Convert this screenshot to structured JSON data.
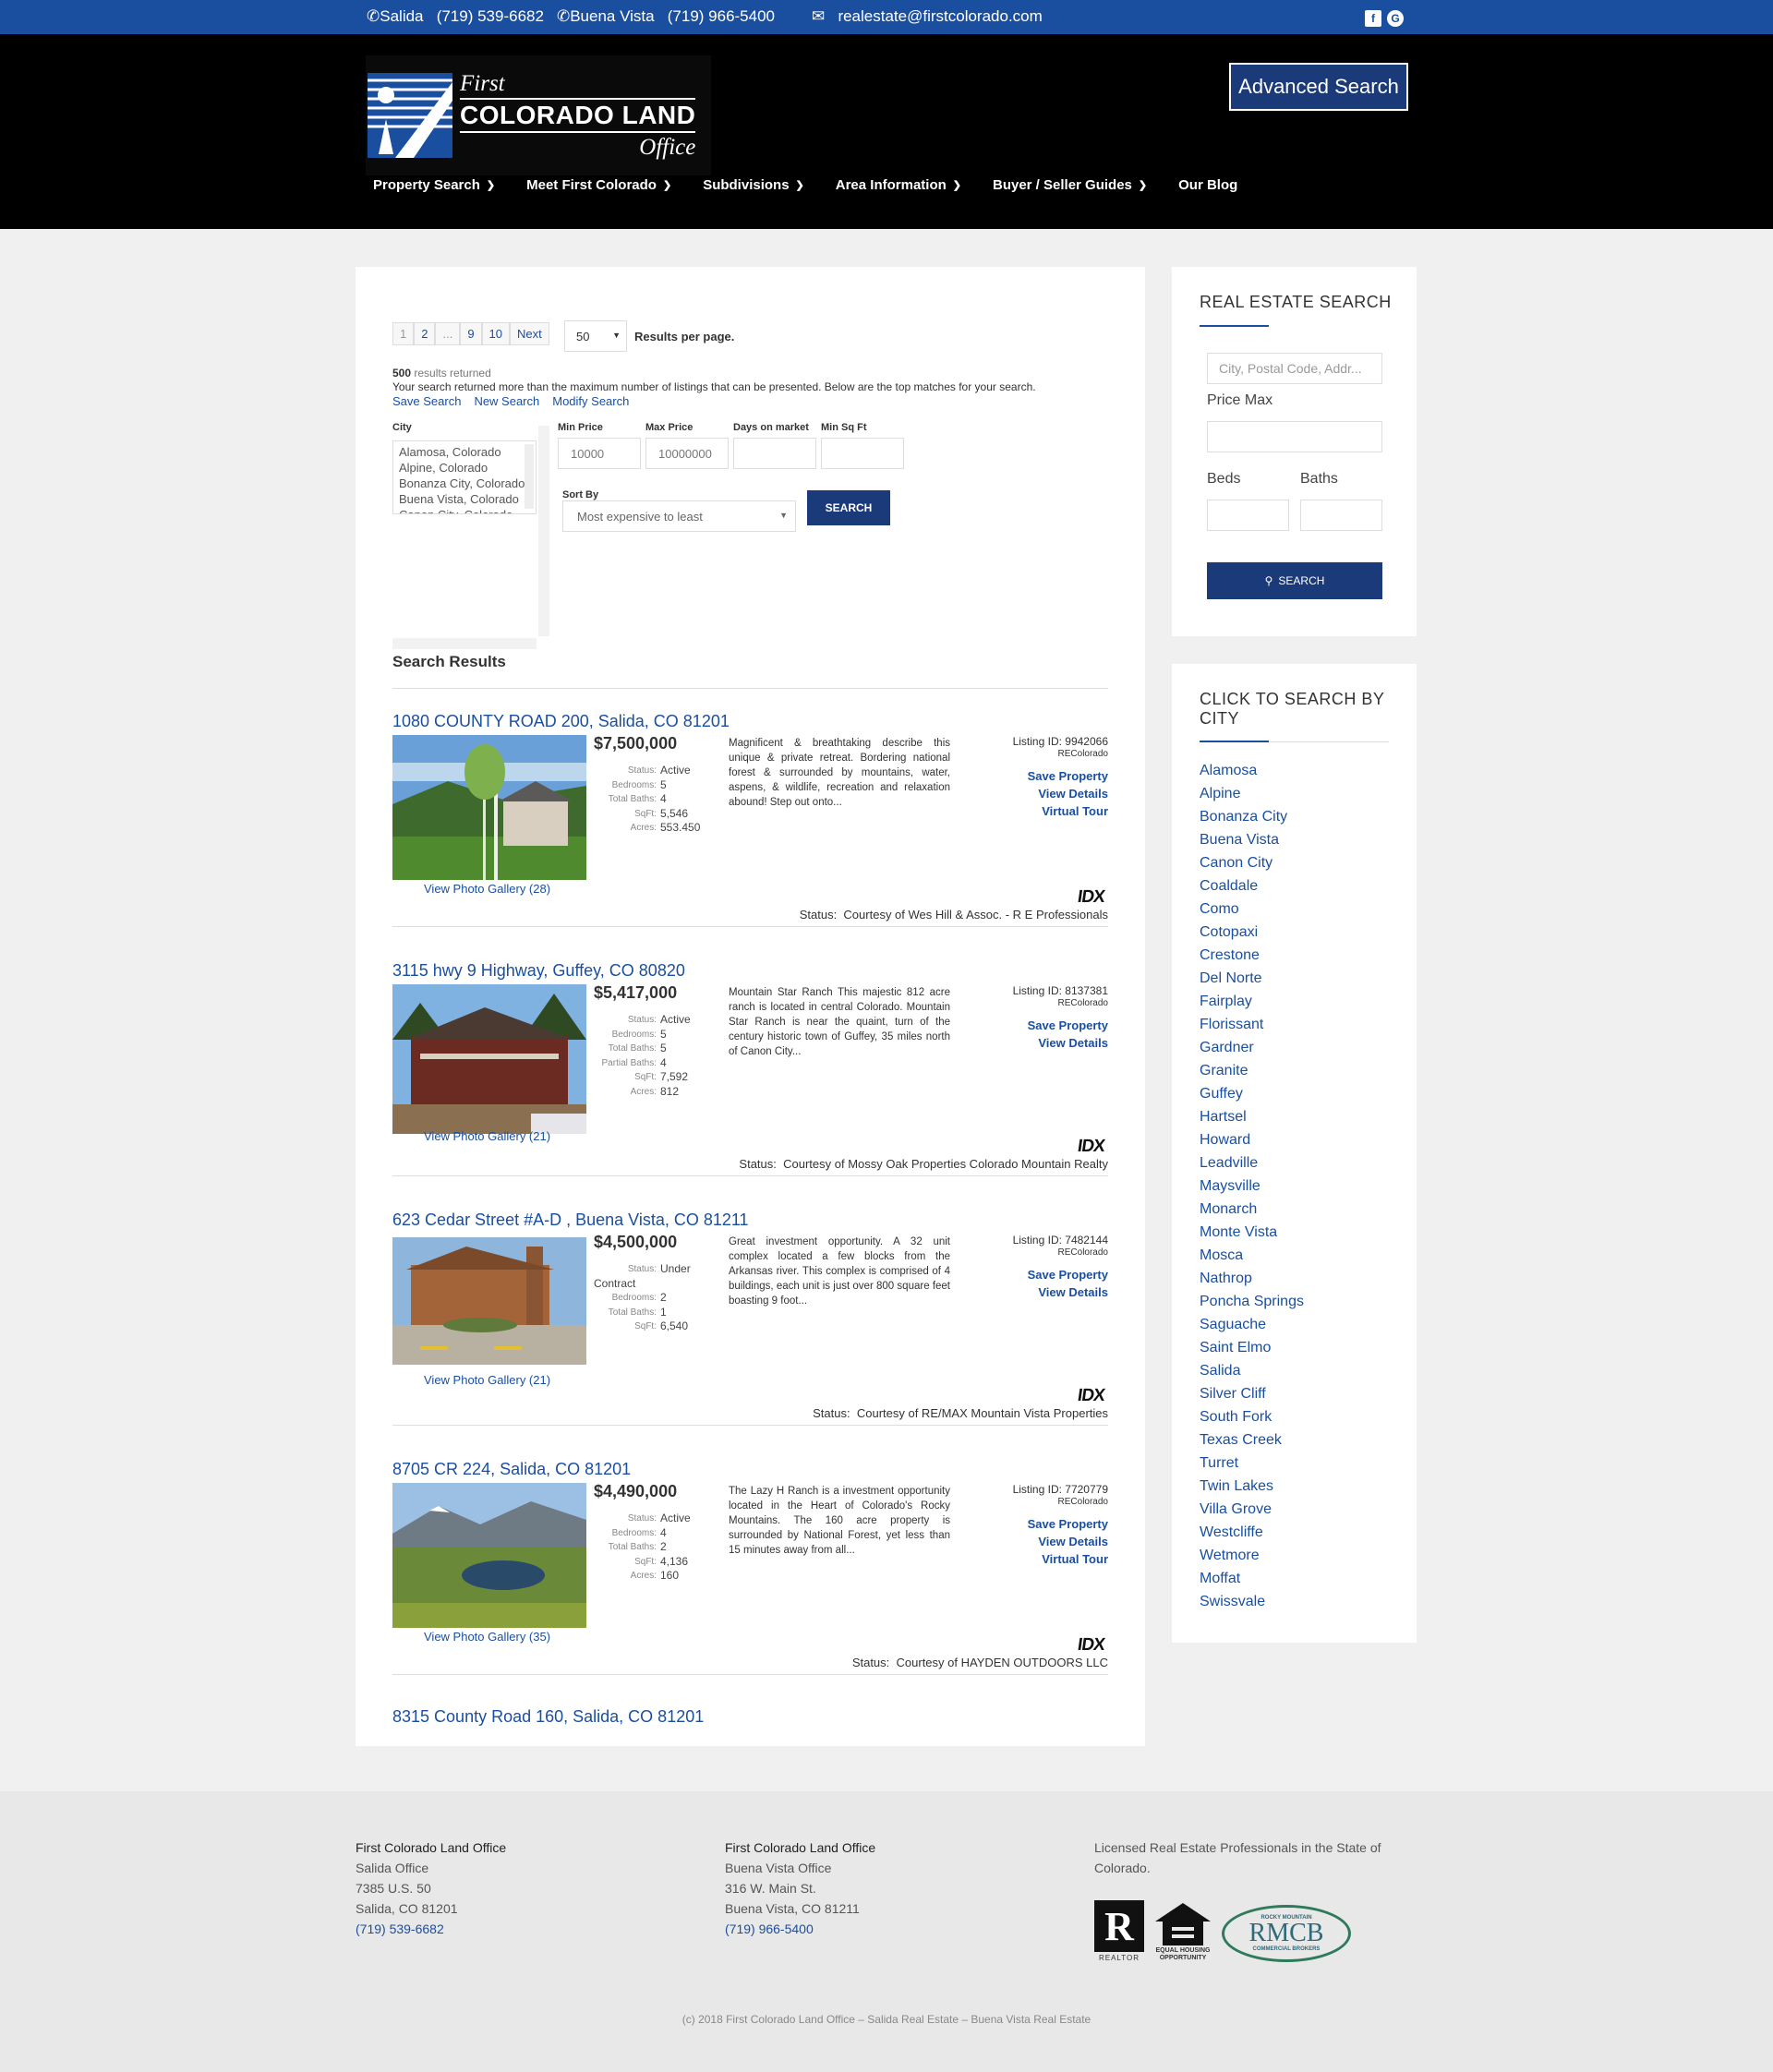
{
  "topbar": {
    "salida_label": "Salida",
    "salida_phone": "(719) 539-6682",
    "bv_label": "Buena Vista",
    "bv_phone": "(719) 966-5400",
    "email": "realestate@firstcolorado.com"
  },
  "logo": {
    "first": "First",
    "main": "COLORADO LAND",
    "office": "Office"
  },
  "header": {
    "advanced_search": "Advanced Search"
  },
  "nav": [
    {
      "label": "Property Search"
    },
    {
      "label": "Meet First Colorado"
    },
    {
      "label": "Subdivisions"
    },
    {
      "label": "Area Information"
    },
    {
      "label": "Buyer / Seller Guides"
    },
    {
      "label": "Our Blog"
    }
  ],
  "pager": {
    "pages": [
      "1",
      "2",
      "...",
      "9",
      "10",
      "Next"
    ],
    "per_page": "50",
    "per_page_label": "Results per page."
  },
  "results_info": {
    "count": "500",
    "count_suffix": "results returned",
    "message": "Your search returned more than the maximum number of listings that can be presented. Below are the top matches for your search.",
    "save_search": "Save Search",
    "new_search": "New Search",
    "modify_search": "Modify Search"
  },
  "filters": {
    "city_label": "City",
    "cities": [
      "Alamosa, Colorado",
      "Alpine, Colorado",
      "Bonanza City, Colorado",
      "Buena Vista, Colorado",
      "Canon City, Colorado"
    ],
    "min_price_label": "Min Price",
    "min_price": "10000",
    "max_price_label": "Max Price",
    "max_price": "10000000",
    "days_label": "Days on market",
    "sqft_label": "Min Sq Ft",
    "sort_label": "Sort By",
    "sort_value": "Most expensive to least",
    "search_button": "SEARCH"
  },
  "search_results_title": "Search Results",
  "listings": [
    {
      "title": "1080 COUNTY ROAD 200, Salida, CO 81201",
      "price": "$7,500,000",
      "status": "Active",
      "bedrooms": "5",
      "total_baths": "4",
      "sqft": "5,546",
      "acres": "553.450",
      "description": "Magnificent & breathtaking describe this unique & private retreat. Bordering national forest & surrounded by mountains, water, aspens, & wildlife, recreation and relaxation abound! Step out onto...",
      "listing_id": "Listing ID: 9942066",
      "source": "REColorado",
      "save": "Save Property",
      "details": "View Details",
      "tour": "Virtual Tour",
      "gallery": "View Photo Gallery (28)",
      "courtesy_label": "Status:",
      "courtesy": "Courtesy of Wes Hill & Assoc. - R E Professionals"
    },
    {
      "title": "3115 hwy 9 Highway, Guffey, CO 80820",
      "price": "$5,417,000",
      "status": "Active",
      "bedrooms": "5",
      "total_baths": "5",
      "partial_baths": "4",
      "sqft": "7,592",
      "acres": "812",
      "description": "Mountain Star Ranch This majestic 812 acre ranch is located in central Colorado. Mountain Star Ranch is near the quaint, turn of the century historic town of Guffey, 35 miles north of Canon City...",
      "listing_id": "Listing ID: 8137381",
      "source": "REColorado",
      "save": "Save Property",
      "details": "View Details",
      "gallery": "View Photo Gallery (21)",
      "courtesy_label": "Status:",
      "courtesy": "Courtesy of Mossy Oak Properties Colorado Mountain Realty"
    },
    {
      "title": "623 Cedar Street #A-D , Buena Vista, CO 81211",
      "price": "$4,500,000",
      "status": "Under",
      "status_cont": "Contract",
      "bedrooms": "2",
      "total_baths": "1",
      "sqft": "6,540",
      "description": "Great investment opportunity. A 32 unit complex located a few blocks from the Arkansas river. This complex is comprised of 4 buildings, each unit is just over 800 square feet boasting 9 foot...",
      "listing_id": "Listing ID: 7482144",
      "source": "REColorado",
      "save": "Save Property",
      "details": "View Details",
      "gallery": "View Photo Gallery (21)",
      "courtesy_label": "Status:",
      "courtesy": "Courtesy of RE/MAX Mountain Vista Properties"
    },
    {
      "title": "8705 CR 224, Salida, CO 81201",
      "price": "$4,490,000",
      "status": "Active",
      "bedrooms": "4",
      "total_baths": "2",
      "sqft": "4,136",
      "acres": "160",
      "description": "The Lazy H Ranch is a investment opportunity located in the Heart of Colorado's Rocky Mountains. The 160 acre property is surrounded by National Forest, yet less than 15 minutes away from all...",
      "listing_id": "Listing ID: 7720779",
      "source": "REColorado",
      "save": "Save Property",
      "details": "View Details",
      "tour": "Virtual Tour",
      "gallery": "View Photo Gallery (35)",
      "courtesy_label": "Status:",
      "courtesy": "Courtesy of HAYDEN OUTDOORS LLC"
    }
  ],
  "spec_labels": {
    "status": "Status:",
    "bedrooms": "Bedrooms:",
    "total_baths": "Total Baths:",
    "partial_baths": "Partial Baths:",
    "sqft": "SqFt:",
    "acres": "Acres:"
  },
  "idx_logo": "IDX",
  "next_listing_title": "8315 County Road 160, Salida, CO 81201",
  "sidebar_search": {
    "title": "REAL ESTATE SEARCH",
    "city_placeholder": "City, Postal Code, Addr...",
    "price_max": "Price Max",
    "beds": "Beds",
    "baths": "Baths",
    "button": "SEARCH"
  },
  "sidebar_cities": {
    "title": "CLICK TO SEARCH BY CITY",
    "cities": [
      "Alamosa",
      "Alpine",
      "Bonanza City",
      "Buena Vista",
      "Canon City",
      "Coaldale",
      "Como",
      "Cotopaxi",
      "Crestone",
      "Del Norte",
      "Fairplay",
      "Florissant",
      "Gardner",
      "Granite",
      "Guffey",
      "Hartsel",
      "Howard",
      "Leadville",
      "Maysville",
      "Monarch",
      "Monte Vista",
      "Mosca",
      "Nathrop",
      "Poncha Springs",
      "Saguache",
      "Saint Elmo",
      "Salida",
      "Silver Cliff",
      "South Fork",
      "Texas Creek",
      "Turret",
      "Twin Lakes",
      "Villa Grove",
      "Westcliffe",
      "Wetmore",
      "Moffat",
      "Swissvale"
    ]
  },
  "footer": {
    "col1": {
      "name": "First Colorado Land Office",
      "office": "Salida Office",
      "street": "7385 U.S. 50",
      "city": "Salida, CO 81201",
      "phone": "(719) 539-6682"
    },
    "col2": {
      "name": "First Colorado Land Office",
      "office": "Buena Vista Office",
      "street": "316 W. Main St.",
      "city": "Buena Vista, CO 81211",
      "phone": "(719) 966-5400"
    },
    "col3": {
      "text": "Licensed Real Estate Professionals in the State of Colorado."
    },
    "logos": {
      "realtor": "REALTOR",
      "eho_line1": "EQUAL HOUSING",
      "eho_line2": "OPPORTUNITY",
      "rmcb_top": "ROCKY MOUNTAIN",
      "rmcb_main": "RMCB",
      "rmcb_bottom": "COMMERCIAL BROKERS"
    },
    "copyright": "(c) 2018 First Colorado Land Office – Salida Real Estate – Buena Vista Real Estate"
  },
  "colors": {
    "topbar": "#1a4fa0",
    "header": "#000000",
    "accent": "#1a3a7a",
    "link": "#1a4fa0"
  }
}
